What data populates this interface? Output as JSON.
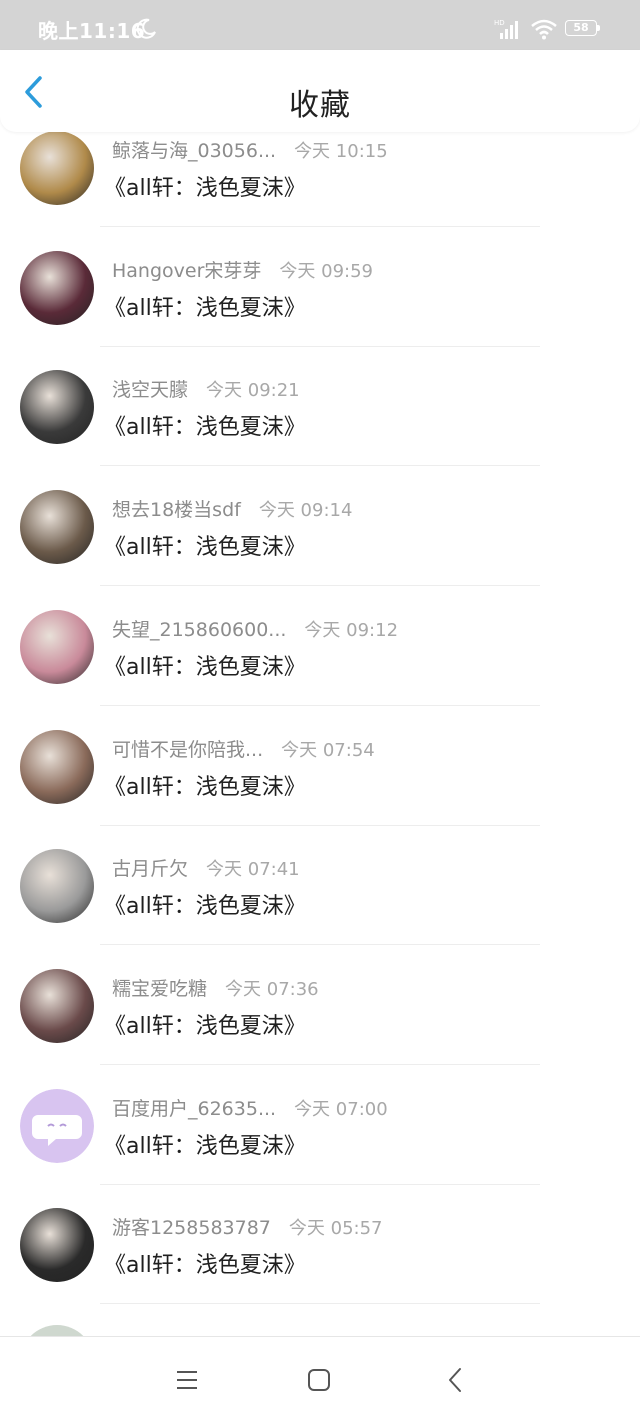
{
  "status_bar": {
    "time": "晚上11:16",
    "battery": "58",
    "icons": [
      "moon-icon",
      "signal-icon",
      "wifi-icon",
      "battery-icon"
    ]
  },
  "header": {
    "title": "收藏",
    "back_icon": "chevron-left-icon",
    "accent_color": "#2d9cdb"
  },
  "items": [
    {
      "user": "鲸落与海_03056...",
      "time": "今天 10:15",
      "title": "《all轩：浅色夏沫》",
      "avatar_color": "#b08a4a"
    },
    {
      "user": "Hangover宋芽芽",
      "time": "今天 09:59",
      "title": "《all轩：浅色夏沫》",
      "avatar_color": "#5a2a38"
    },
    {
      "user": "浅空天朦",
      "time": "今天 09:21",
      "title": "《all轩：浅色夏沫》",
      "avatar_color": "#3a3a3a"
    },
    {
      "user": "想去18楼当sdf",
      "time": "今天 09:14",
      "title": "《all轩：浅色夏沫》",
      "avatar_color": "#6b5a4a"
    },
    {
      "user": "失望_215860600...",
      "time": "今天 09:12",
      "title": "《all轩：浅色夏沫》",
      "avatar_color": "#c98a9a"
    },
    {
      "user": "可惜不是你陪我...",
      "time": "今天 07:54",
      "title": "《all轩：浅色夏沫》",
      "avatar_color": "#8a6a5a"
    },
    {
      "user": "古月斤欠",
      "time": "今天 07:41",
      "title": "《all轩：浅色夏沫》",
      "avatar_color": "#9a9a9a"
    },
    {
      "user": "糯宝爱吃糖",
      "time": "今天 07:36",
      "title": "《all轩：浅色夏沫》",
      "avatar_color": "#6a4a4a"
    },
    {
      "user": "百度用户_62635...",
      "time": "今天 07:00",
      "title": "《all轩：浅色夏沫》",
      "avatar_color": "#d8c4f0"
    },
    {
      "user": "游客1258583787",
      "time": "今天 05:57",
      "title": "《all轩：浅色夏沫》",
      "avatar_color": "#2a2a2a"
    }
  ],
  "nav_bar": {
    "icons": [
      "menu-icon",
      "home-square-icon",
      "back-triangle-icon"
    ]
  }
}
